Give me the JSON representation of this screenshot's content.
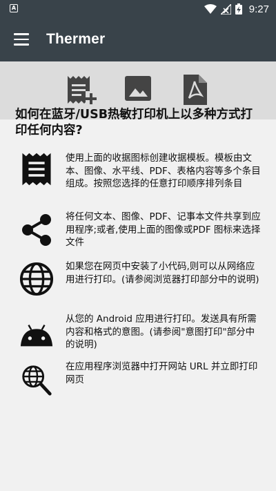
{
  "status": {
    "time": "9:27"
  },
  "app": {
    "title": "Thermer"
  },
  "toolbar": {
    "buttons": [
      {
        "icon": "receipt-add-icon"
      },
      {
        "icon": "image-icon"
      },
      {
        "icon": "pdf-icon"
      }
    ]
  },
  "main": {
    "heading": "如何在蓝牙/USB热敏打印机上以多种方式打印任何内容?",
    "items": [
      {
        "icon": "receipt-icon",
        "text": "使用上面的收据图标创建收据模板。模板由文本、图像、水平线、PDF、表格内容等多个条目组成。按照您选择的任意打印顺序排列条目"
      },
      {
        "icon": "share-icon",
        "text": "将任何文本、图像、PDF、记事本文件共享到应用程序;或者,使用上面的图像或PDF 图标来选择文件"
      },
      {
        "icon": "globe-icon",
        "text": "如果您在网页中安装了小代码,则可以从网络应用进行打印。(请参阅浏览器打印部分中的说明)"
      },
      {
        "icon": "android-icon",
        "text": "从您的 Android 应用进行打印。发送具有所需内容和格式的意图。(请参阅\"意图打印\"部分中的说明)"
      },
      {
        "icon": "web-search-icon",
        "text": "在应用程序浏览器中打开网站 URL 并立即打印网页"
      }
    ]
  }
}
